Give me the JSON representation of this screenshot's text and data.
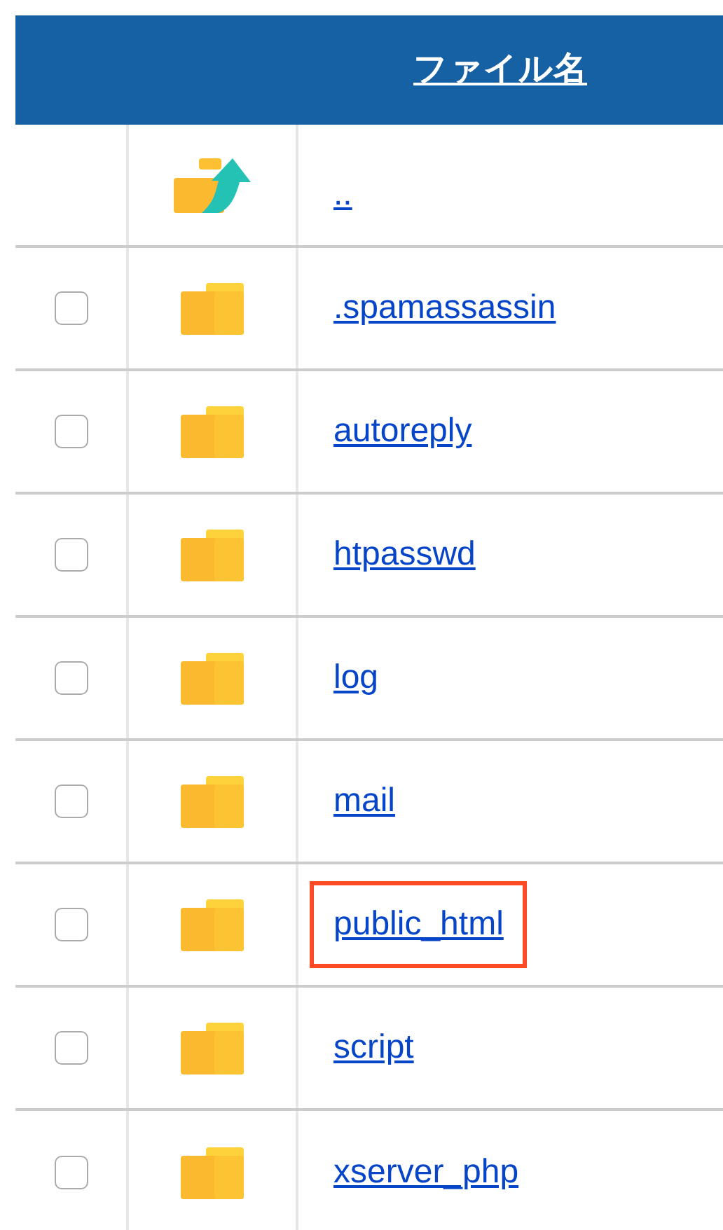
{
  "table": {
    "columns": [
      {
        "label": "ファイル名"
      }
    ],
    "rows": [
      {
        "kind": "parent",
        "name": "..",
        "highlighted": false
      },
      {
        "kind": "folder",
        "name": ".spamassassin",
        "checked": false,
        "highlighted": false
      },
      {
        "kind": "folder",
        "name": "autoreply",
        "checked": false,
        "highlighted": false
      },
      {
        "kind": "folder",
        "name": "htpasswd",
        "checked": false,
        "highlighted": false
      },
      {
        "kind": "folder",
        "name": "log",
        "checked": false,
        "highlighted": false
      },
      {
        "kind": "folder",
        "name": "mail",
        "checked": false,
        "highlighted": false
      },
      {
        "kind": "folder",
        "name": "public_html",
        "checked": false,
        "highlighted": true
      },
      {
        "kind": "folder",
        "name": "script",
        "checked": false,
        "highlighted": false
      },
      {
        "kind": "folder",
        "name": "xserver_php",
        "checked": false,
        "highlighted": false
      }
    ]
  }
}
